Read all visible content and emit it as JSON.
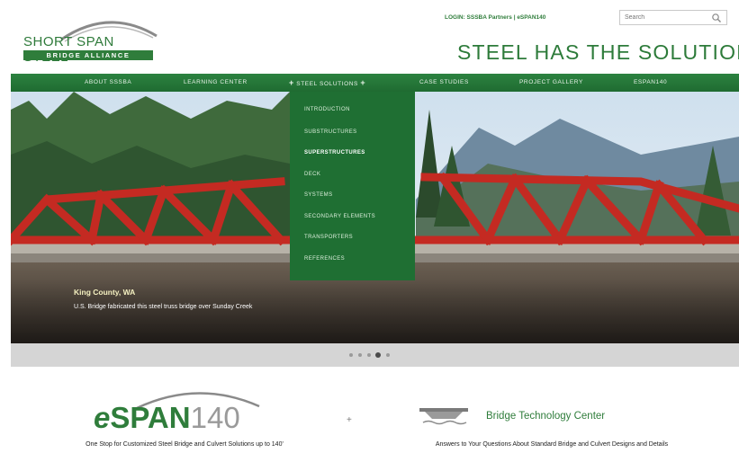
{
  "header": {
    "logo_name": "SHORT SPAN STEEL",
    "logo_bar": "BRIDGE ALLIANCE",
    "top_links": "LOGIN: SSSBA Partners | eSPAN140",
    "search_placeholder": "Search",
    "tagline": "STEEL HAS THE SOLUTION"
  },
  "nav": {
    "items": [
      {
        "label": "ABOUT SSSBA"
      },
      {
        "label": "LEARNING CENTER"
      },
      {
        "label": "STEEL SOLUTIONS"
      },
      {
        "label": "CASE STUDIES"
      },
      {
        "label": "PROJECT GALLERY"
      },
      {
        "label": "ESPAN140"
      }
    ],
    "plus": "+"
  },
  "dropdown": {
    "items": [
      {
        "label": "INTRODUCTION"
      },
      {
        "label": "SUBSTRUCTURES"
      },
      {
        "label": "SUPERSTRUCTURES"
      },
      {
        "label": "DECK"
      },
      {
        "label": "SYSTEMS"
      },
      {
        "label": "SECONDARY ELEMENTS"
      },
      {
        "label": "TRANSPORTERS"
      },
      {
        "label": "REFERENCES"
      }
    ],
    "active_index": 2
  },
  "hero": {
    "caption_title": "King County, WA",
    "caption_text": "U.S. Bridge fabricated this steel truss bridge over Sunday Creek"
  },
  "slider": {
    "count": 5,
    "active_index": 3
  },
  "espan": {
    "e": "e",
    "span": "SPAN",
    "num": "140",
    "desc": "One Stop for Customized Steel Bridge and Culvert Solutions up to 140'"
  },
  "separator": "+",
  "btc": {
    "title": "Bridge Technology Center",
    "desc": "Answers to Your Questions About Standard Bridge and Culvert Designs and Details"
  },
  "colors": {
    "brand_green": "#2f7d3b",
    "dropdown_green": "#1f6f33",
    "bridge_red": "#c42a22"
  }
}
